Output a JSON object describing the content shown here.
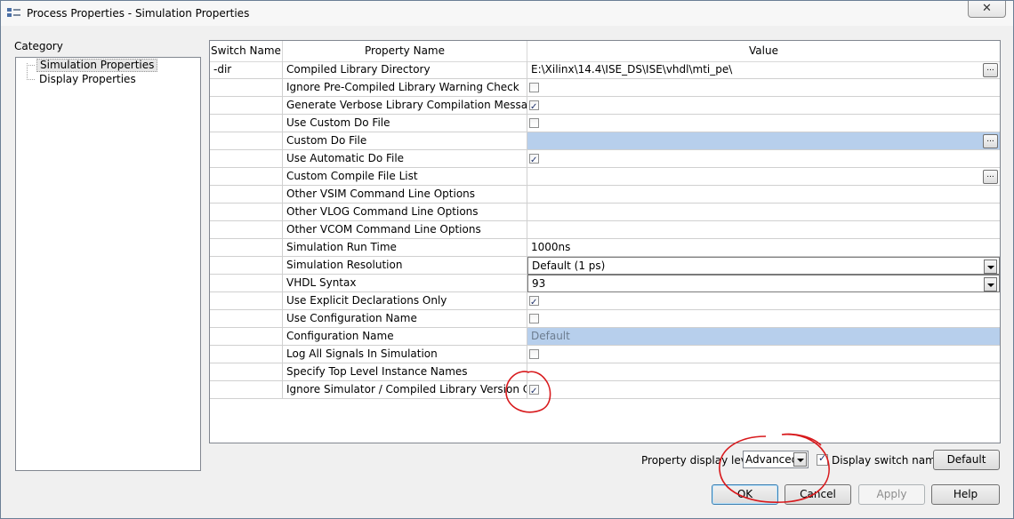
{
  "window": {
    "title": "Process Properties - Simulation Properties",
    "close_label": "✕"
  },
  "category": {
    "label": "Category",
    "items": [
      {
        "label": "Simulation Properties",
        "selected": true
      },
      {
        "label": "Display Properties",
        "selected": false
      }
    ]
  },
  "grid": {
    "headers": {
      "switch": "Switch Name",
      "property": "Property Name",
      "value": "Value"
    },
    "rows": [
      {
        "switch": "-dir",
        "property": "Compiled Library Directory",
        "type": "text-browse",
        "value": "E:\\Xilinx\\14.4\\ISE_DS\\ISE\\vhdl\\mti_pe\\"
      },
      {
        "switch": "",
        "property": "Ignore Pre-Compiled Library Warning Check",
        "type": "checkbox",
        "checked": false
      },
      {
        "switch": "",
        "property": "Generate Verbose Library Compilation Messages",
        "type": "checkbox",
        "checked": true
      },
      {
        "switch": "",
        "property": "Use Custom Do File",
        "type": "checkbox",
        "checked": false
      },
      {
        "switch": "",
        "property": "Custom Do File",
        "type": "browse-disabled",
        "value": ""
      },
      {
        "switch": "",
        "property": "Use Automatic Do File",
        "type": "checkbox",
        "checked": true
      },
      {
        "switch": "",
        "property": "Custom Compile File List",
        "type": "browse",
        "value": ""
      },
      {
        "switch": "",
        "property": "Other VSIM Command Line Options",
        "type": "text",
        "value": ""
      },
      {
        "switch": "",
        "property": "Other VLOG Command Line Options",
        "type": "text",
        "value": ""
      },
      {
        "switch": "",
        "property": "Other VCOM Command Line Options",
        "type": "text",
        "value": ""
      },
      {
        "switch": "",
        "property": "Simulation Run Time",
        "type": "text",
        "value": "1000ns"
      },
      {
        "switch": "",
        "property": "Simulation Resolution",
        "type": "dropdown",
        "value": "Default (1 ps)"
      },
      {
        "switch": "",
        "property": "VHDL Syntax",
        "type": "dropdown",
        "value": "93"
      },
      {
        "switch": "",
        "property": "Use Explicit Declarations Only",
        "type": "checkbox",
        "checked": true
      },
      {
        "switch": "",
        "property": "Use Configuration Name",
        "type": "checkbox",
        "checked": false
      },
      {
        "switch": "",
        "property": "Configuration Name",
        "type": "text-disabled",
        "value": "Default"
      },
      {
        "switch": "",
        "property": "Log All Signals In Simulation",
        "type": "checkbox",
        "checked": false
      },
      {
        "switch": "",
        "property": "Specify Top Level Instance Names",
        "type": "text",
        "value": ""
      },
      {
        "switch": "",
        "property": "Ignore Simulator / Compiled Library Version Check",
        "type": "checkbox",
        "checked": true
      }
    ]
  },
  "footer": {
    "display_level_label": "Property display level:",
    "display_level_value": "Advanced",
    "display_switch_label": "Display switch names",
    "display_switch_checked": true,
    "default_label": "Default",
    "ok_label": "OK",
    "cancel_label": "Cancel",
    "apply_label": "Apply",
    "help_label": "Help"
  },
  "colors": {
    "selection_blue": "#b7cfec",
    "disabled_blue": "#b7cfec",
    "annotation_red": "#d8191c"
  }
}
